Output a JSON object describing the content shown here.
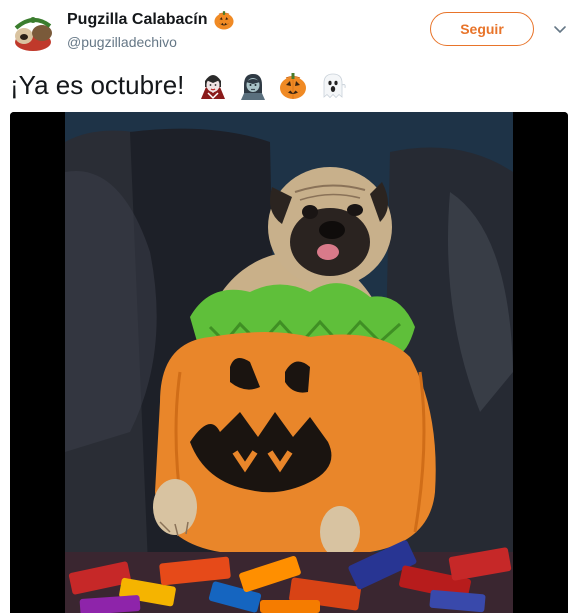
{
  "author": {
    "display_name": "Pugzilla Calabacín",
    "handle": "@pugzilladechivo",
    "name_emoji": "jack-o-lantern-icon"
  },
  "follow_label": "Seguir",
  "tweet": {
    "text": "¡Ya es octubre!",
    "emojis": [
      "vampire-woman-icon",
      "zombie-woman-icon",
      "jack-o-lantern-icon",
      "ghost-icon"
    ]
  },
  "media": {
    "type": "video",
    "description_icon": "video-frame"
  },
  "colors": {
    "accent": "#e8742a",
    "handle": "#657786",
    "text": "#14171a"
  }
}
